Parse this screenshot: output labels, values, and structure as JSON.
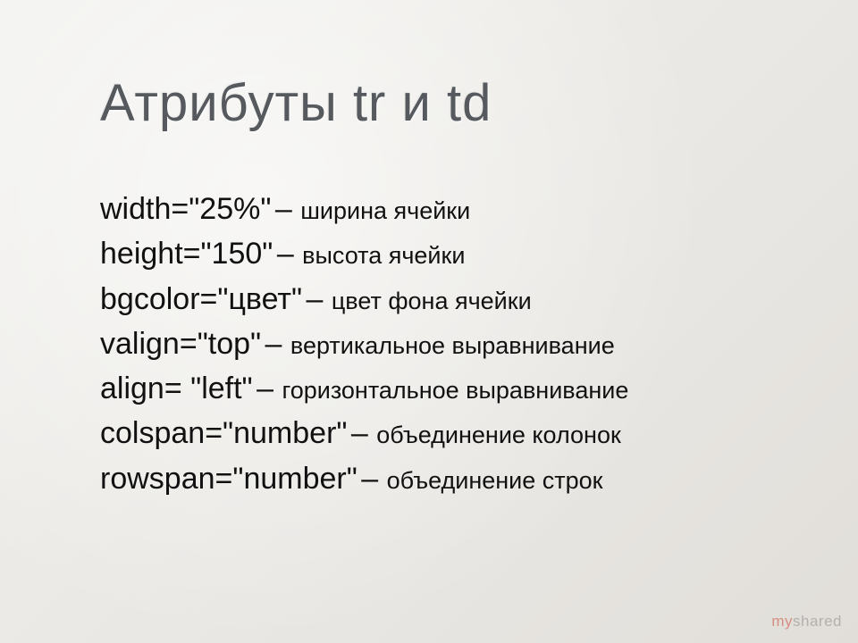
{
  "title": "Атрибуты tr и td",
  "lines": [
    {
      "attr": "width=\"25%\"",
      "desc": "ширина ячейки"
    },
    {
      "attr": "height=\"150\"",
      "desc": "высота ячейки"
    },
    {
      "attr": "bgcolor=\"цвет\"",
      "desc": "цвет фона ячейки"
    },
    {
      "attr": "valign=\"top\"",
      "desc": "вертикальное выравнивание"
    },
    {
      "attr": "align= \"left\"",
      "desc": "горизонтальное выравнивание"
    },
    {
      "attr": "colspan=\"number\"",
      "desc": "объединение колонок"
    },
    {
      "attr": "rowspan=\"number\"",
      "desc": "объединение строк"
    }
  ],
  "watermark": {
    "prefix": "my",
    "suffix": "shared"
  }
}
